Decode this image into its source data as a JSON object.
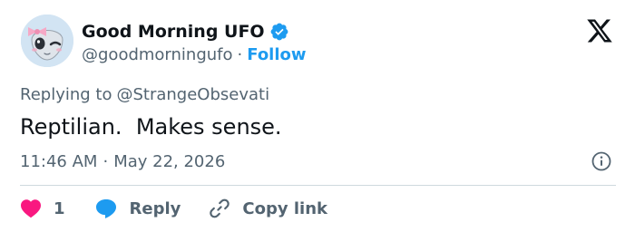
{
  "author": {
    "display_name": "Good Morning UFO",
    "handle": "@goodmorningufo",
    "separator": "·",
    "follow_label": "Follow",
    "verified_color": "#1d9bf0"
  },
  "reply_context": {
    "prefix": "Replying to",
    "handle": "@StrangeObsevati"
  },
  "tweet": {
    "text": "Reptilian.  Makes sense.",
    "time": "11:46 AM",
    "separator": "·",
    "date": "May 22, 2026"
  },
  "actions": {
    "like_count": "1",
    "reply_label": "Reply",
    "copy_label": "Copy link"
  },
  "colors": {
    "accent": "#1d9bf0",
    "like": "#f91880",
    "text": "#0f1419",
    "muted": "#536471"
  },
  "icons": [
    "alien-avatar",
    "verified-badge-icon",
    "x-logo-icon",
    "info-icon",
    "heart-icon",
    "reply-bubble-icon",
    "link-icon"
  ]
}
